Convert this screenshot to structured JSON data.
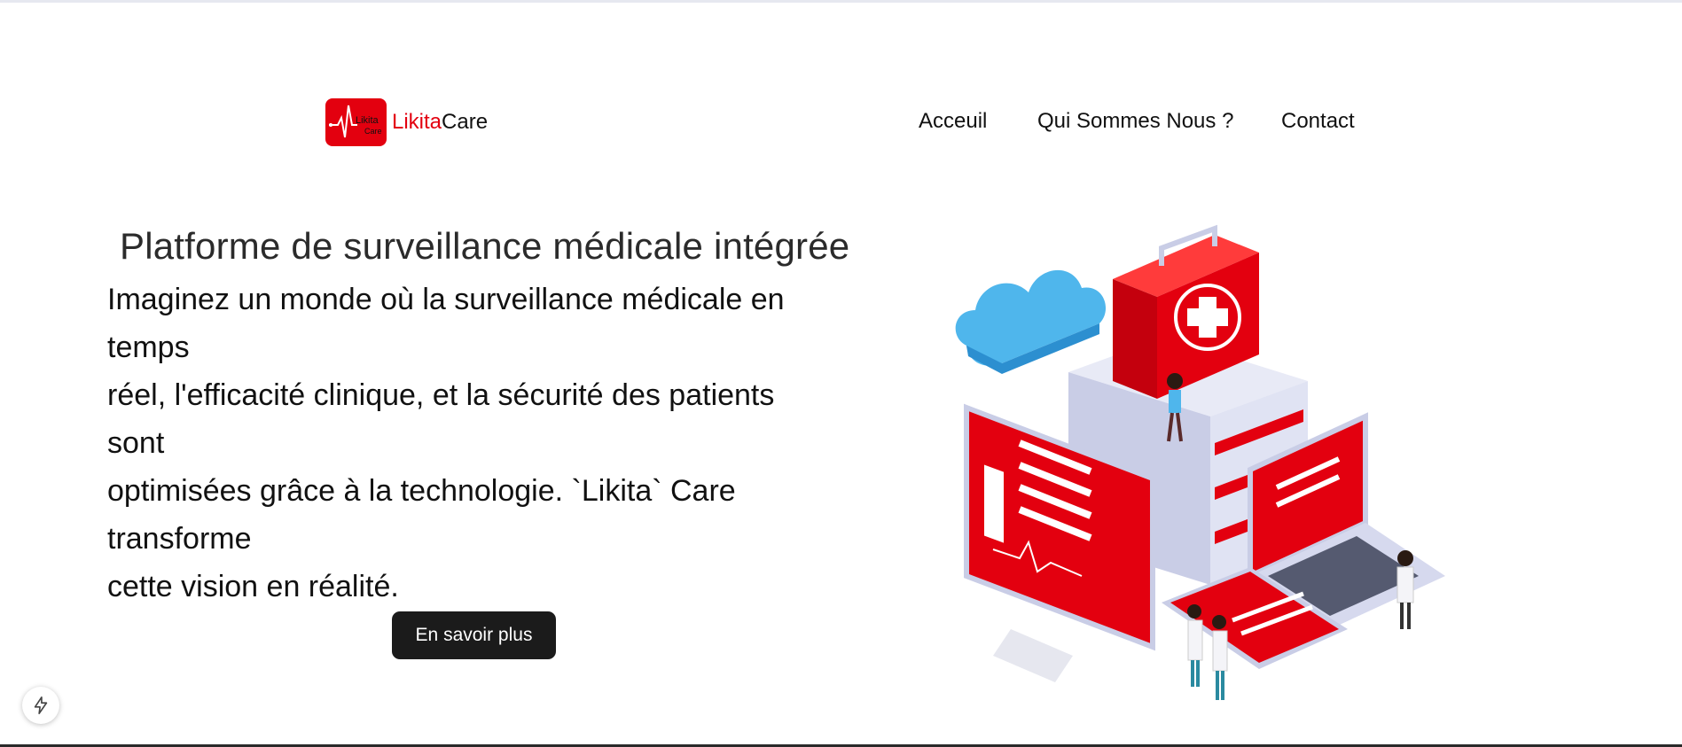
{
  "logo": {
    "badge_top": "Likita",
    "badge_bottom": "Care",
    "name_red": "Likita",
    "name_dark": "Care"
  },
  "nav": {
    "items": [
      "Acceuil",
      "Qui Sommes Nous ?",
      "Contact"
    ]
  },
  "hero": {
    "subtitle": "Platforme de surveillance médicale intégrée",
    "lines": [
      "Imaginez un monde où la surveillance médicale en",
      "temps",
      "réel, l'efficacité clinique, et la sécurité des patients",
      "sont",
      "optimisées grâce à la technologie. `Likita` Care",
      "transforme",
      "cette vision en réalité."
    ],
    "cta": "En savoir plus"
  },
  "colors": {
    "brand_red": "#e3000f",
    "dark": "#1b1b1b",
    "cloud": "#4fb6ec",
    "device_grey": "#c9cde6"
  },
  "icons": {
    "floating": "lightning-icon"
  }
}
